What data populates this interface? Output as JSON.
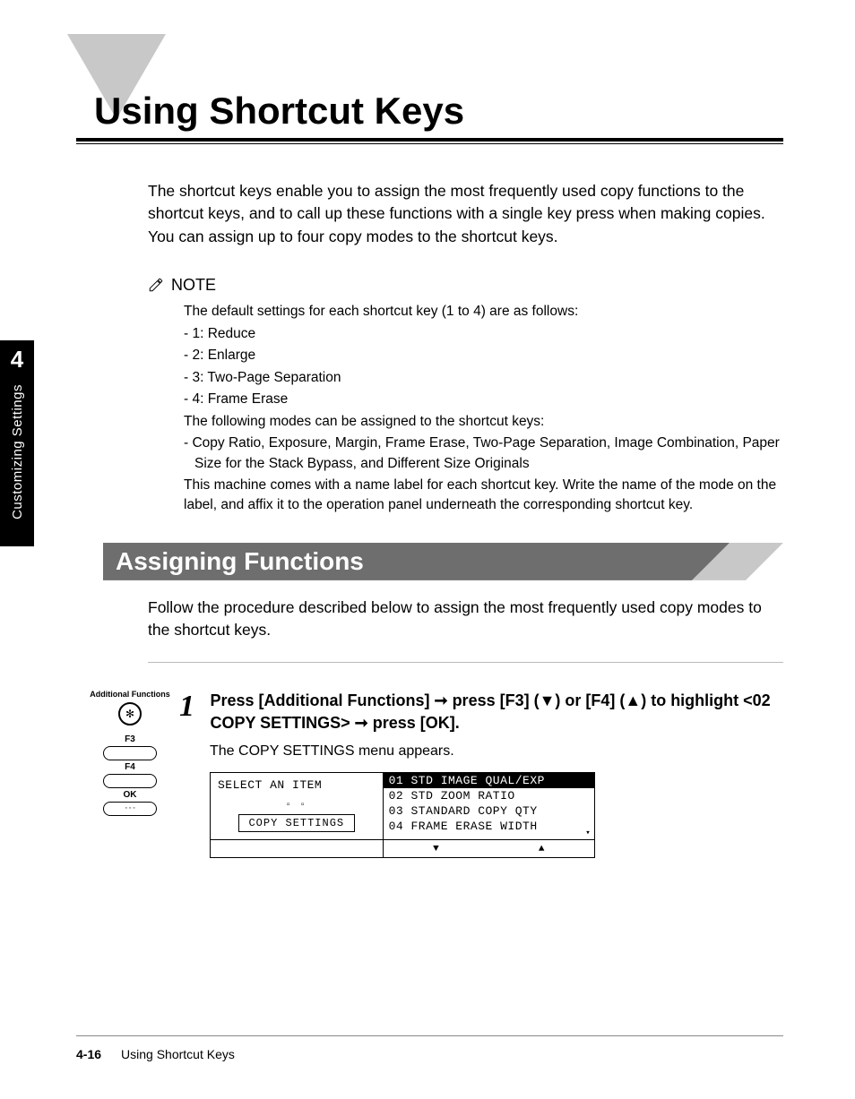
{
  "chapter": {
    "title": "Using Shortcut Keys"
  },
  "side_tab": {
    "number": "4",
    "label": "Customizing Settings"
  },
  "intro": "The shortcut keys enable you to assign the most frequently used copy functions to the shortcut keys, and to call up these functions with a single key press when making copies. You can assign up to four copy modes to the shortcut keys.",
  "note": {
    "label": "NOTE",
    "line1": "The default settings for each shortcut key (1 to 4) are as follows:",
    "items": [
      "- 1: Reduce",
      "- 2: Enlarge",
      "- 3: Two-Page Separation",
      "- 4: Frame Erase"
    ],
    "line2": "The following modes can be assigned to the shortcut keys:",
    "modes": "- Copy Ratio, Exposure, Margin, Frame Erase, Two-Page Separation, Image Combination, Paper Size for the Stack Bypass, and Different Size Originals",
    "affix": "This machine comes with a name label for each shortcut key. Write the name of the mode on the label, and affix it to the operation panel underneath the corresponding shortcut key."
  },
  "section": {
    "title": "Assigning Functions"
  },
  "section_intro": "Follow the procedure described below to assign the most frequently used copy modes to the shortcut keys.",
  "keys": {
    "af_label": "Additional Functions",
    "af_glyph": "✻",
    "f3": "F3",
    "f4": "F4",
    "ok": "OK"
  },
  "step": {
    "num": "1",
    "head_a": "Press [Additional Functions] ",
    "head_b": " press [F3] (▼) or [F4] (▲) to highlight <02 COPY SETTINGS> ",
    "head_c": " press [OK].",
    "arrow": "➞",
    "sub": "The COPY SETTINGS menu appears."
  },
  "lcd": {
    "left_title": "SELECT AN ITEM",
    "left_dots": "▫ ▫",
    "left_box": "COPY SETTINGS",
    "rows": [
      "01 STD IMAGE QUAL/EXP",
      "02 STD ZOOM RATIO",
      "03 STANDARD COPY QTY",
      "04 FRAME ERASE WIDTH"
    ],
    "down": "▼",
    "up": "▲",
    "scroll_up": "▴",
    "scroll_dn": "▾"
  },
  "footer": {
    "page": "4-16",
    "title": "Using Shortcut Keys"
  }
}
